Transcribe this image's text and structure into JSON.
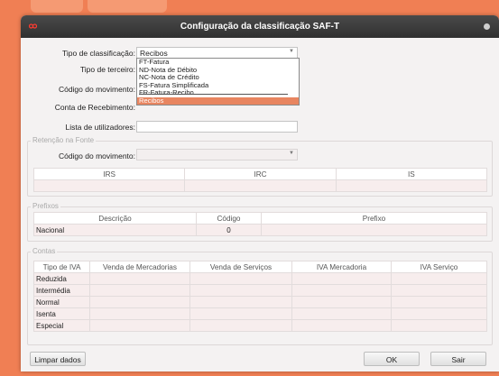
{
  "window": {
    "title": "Configuração da classificação SAF-T"
  },
  "form": {
    "tipo_classificacao": {
      "label": "Tipo de classificação:",
      "value": "Recibos"
    },
    "tipo_terceiro": {
      "label": "Tipo de terceiro:"
    },
    "codigo_movimento": {
      "label": "Código do movimento:"
    },
    "conta_recebimento": {
      "label": "Conta de Recebimento:"
    },
    "lista_utilizadores": {
      "label": "Lista de utilizadores:",
      "value": ""
    }
  },
  "dropdown": {
    "options": [
      {
        "label": "FT-Fatura"
      },
      {
        "label": "ND-Nota de Débito"
      },
      {
        "label": "NC-Nota de Crédito"
      },
      {
        "label": "FS-Fatura Simplificada"
      },
      {
        "label": "FR-Fatura-Recibo"
      },
      {
        "label": "Recibos"
      }
    ]
  },
  "retencao": {
    "legend": "Retenção na Fonte",
    "codigo_label": "Código do movimento:",
    "columns": [
      "IRS",
      "IRC",
      "IS"
    ]
  },
  "prefixos": {
    "legend": "Prefixos",
    "columns": [
      "Descrição",
      "Código",
      "Prefixo"
    ],
    "rows": [
      [
        "Nacional",
        "0",
        ""
      ]
    ]
  },
  "contas": {
    "legend": "Contas",
    "columns": [
      "Tipo de IVA",
      "Venda de Mercadorias",
      "Venda de Serviços",
      "IVA Mercadoria",
      "IVA Serviço"
    ],
    "rows": [
      "Reduzida",
      "Intermédia",
      "Normal",
      "Isenta",
      "Especial"
    ]
  },
  "buttons": {
    "limpar": "Limpar dados",
    "ok": "OK",
    "sair": "Sair"
  },
  "colors": {
    "accent": "#e88560",
    "background": "#f07f54",
    "titlebar": "#363636"
  }
}
